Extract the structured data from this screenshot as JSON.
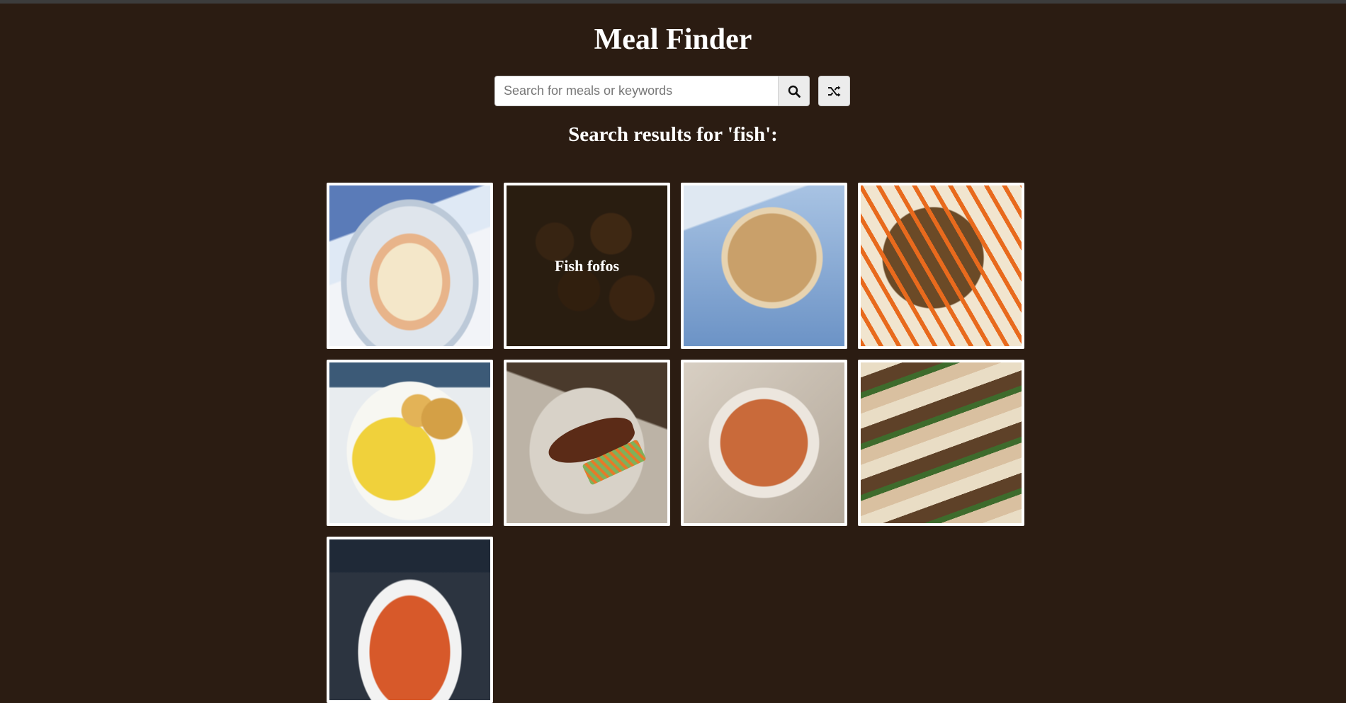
{
  "app": {
    "title": "Meal Finder"
  },
  "search": {
    "placeholder": "Search for meals or keywords",
    "value": "",
    "search_icon": "search-icon",
    "random_icon": "shuffle-icon"
  },
  "results": {
    "heading": "Search results for 'fish':",
    "meals": [
      {
        "name": "",
        "image": "fish-pie"
      },
      {
        "name": "Fish fofos",
        "image": "fish-fofos"
      },
      {
        "name": "",
        "image": "fish-bake"
      },
      {
        "name": "",
        "image": "fried-fish-carrots"
      },
      {
        "name": "",
        "image": "ackee-saltfish"
      },
      {
        "name": "",
        "image": "grilled-sardines"
      },
      {
        "name": "",
        "image": "seafood-soup"
      },
      {
        "name": "",
        "image": "fish-tacos"
      },
      {
        "name": "",
        "image": "mussel-stew"
      }
    ]
  },
  "colors": {
    "background": "#2b1c12",
    "text": "#ffffff",
    "card_border": "#ffffff"
  }
}
